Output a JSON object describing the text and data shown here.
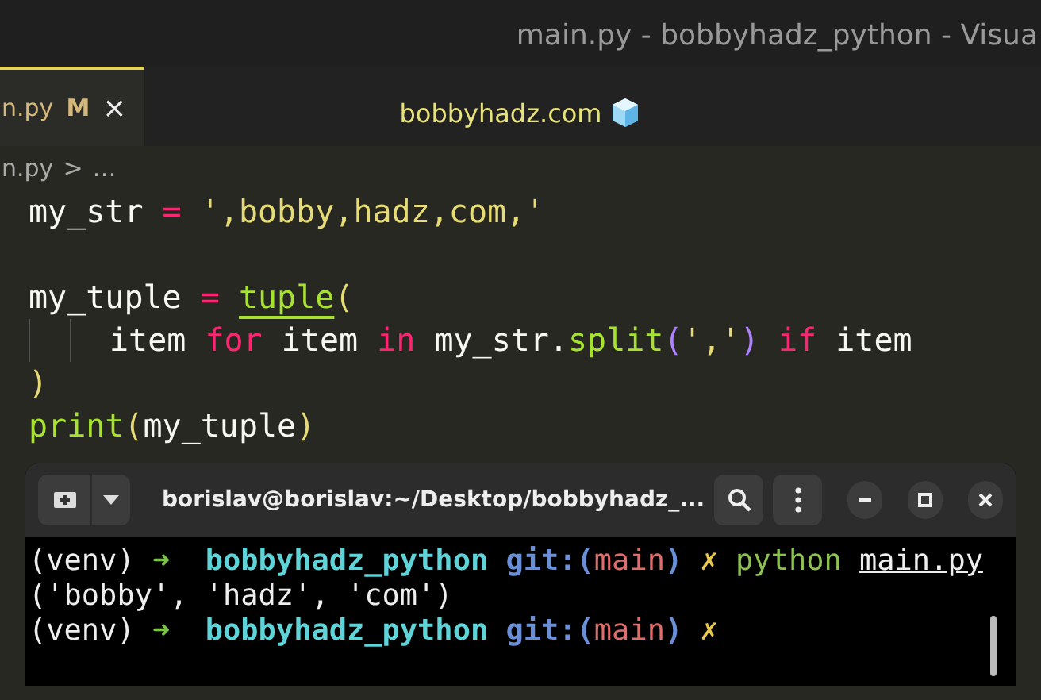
{
  "window": {
    "title": "main.py - bobbyhadz_python - Visua"
  },
  "tabs": [
    {
      "label": "n.py",
      "badge": "M",
      "close": "×",
      "selected": true
    }
  ],
  "editor_title": "bobbyhadz.com",
  "breadcrumb": {
    "file": "n.py",
    "separator": ">",
    "more": "…"
  },
  "code_lines": [
    {
      "guides": false,
      "tokens": [
        {
          "kind": "plain",
          "text": "my_str "
        },
        {
          "kind": "op",
          "text": "= "
        },
        {
          "kind": "str",
          "text": "',bobby,hadz,com,'"
        }
      ]
    },
    {
      "guides": false
    },
    {
      "guides": false,
      "tokens": [
        {
          "kind": "plain",
          "text": "my_tuple "
        },
        {
          "kind": "op",
          "text": "= "
        },
        {
          "kind": "func",
          "text": "tuple",
          "underline": true
        },
        {
          "kind": "paren",
          "text": "("
        }
      ]
    },
    {
      "guides": true,
      "tokens": [
        {
          "kind": "plain",
          "text": "item "
        },
        {
          "kind": "keyword",
          "text": "for"
        },
        {
          "kind": "plain",
          "text": " item "
        },
        {
          "kind": "keyword",
          "text": "in"
        },
        {
          "kind": "plain",
          "text": " my_str."
        },
        {
          "kind": "func",
          "text": "split"
        },
        {
          "kind": "paren2",
          "text": "("
        },
        {
          "kind": "str",
          "text": "','"
        },
        {
          "kind": "paren2",
          "text": ") "
        },
        {
          "kind": "keyword",
          "text": "if"
        },
        {
          "kind": "plain",
          "text": " item"
        }
      ]
    },
    {
      "guides": false,
      "tokens": [
        {
          "kind": "paren",
          "text": ")"
        }
      ]
    },
    {
      "guides": false,
      "tokens": [
        {
          "kind": "func",
          "text": "print"
        },
        {
          "kind": "paren",
          "text": "("
        },
        {
          "kind": "plain",
          "text": "my_tuple"
        },
        {
          "kind": "paren",
          "text": ")"
        }
      ]
    }
  ],
  "terminal": {
    "title": "borislav@borislav:~/Desktop/bobbyhadz_...",
    "lines": [
      [
        {
          "kind": "plain",
          "text": "(venv) "
        },
        {
          "kind": "arrow",
          "text": "➜"
        },
        {
          "kind": "dir",
          "text": "  bobbyhadz_python"
        },
        {
          "kind": "git",
          "text": " git:("
        },
        {
          "kind": "branch",
          "text": "main"
        },
        {
          "kind": "git",
          "text": ")"
        },
        {
          "kind": "mark",
          "text": " ✗ "
        },
        {
          "kind": "cmd",
          "text": "python "
        },
        {
          "kind": "link",
          "text": "main.py"
        }
      ],
      [
        {
          "kind": "plain",
          "text": "('bobby', 'hadz', 'com')"
        }
      ],
      [
        {
          "kind": "plain",
          "text": "(venv) "
        },
        {
          "kind": "arrow",
          "text": "➜"
        },
        {
          "kind": "dir",
          "text": "  bobbyhadz_python"
        },
        {
          "kind": "git",
          "text": " git:("
        },
        {
          "kind": "branch",
          "text": "main"
        },
        {
          "kind": "git",
          "text": ")"
        },
        {
          "kind": "mark",
          "text": " ✗"
        }
      ]
    ]
  }
}
